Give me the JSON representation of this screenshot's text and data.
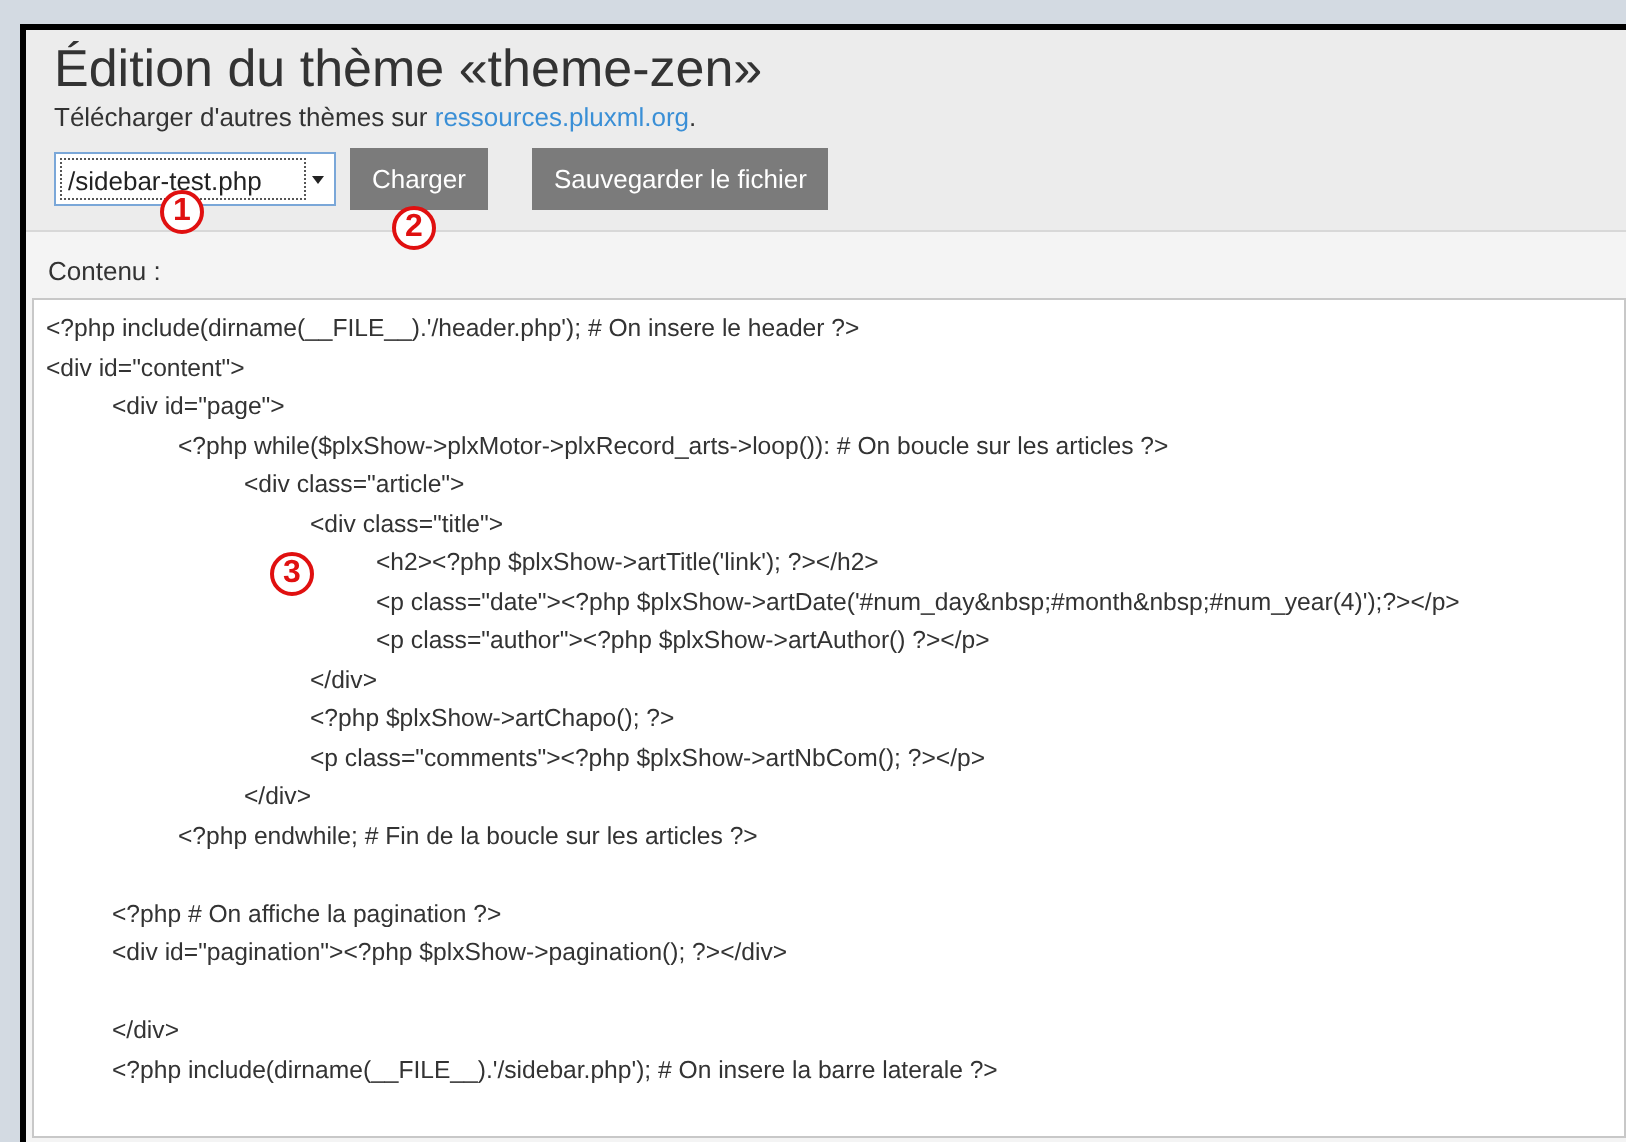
{
  "title": "Édition du thème «theme-zen»",
  "download": {
    "text": "Télécharger d'autres thèmes sur ",
    "link": "ressources.pluxml.org",
    "after": "."
  },
  "file_select": {
    "value": "/sidebar-test.php"
  },
  "buttons": [
    "Charger",
    "Sauvegarder le fichier"
  ],
  "content_label": "Contenu :",
  "content": "<?php include(dirname(__FILE__).'/header.php'); # On insere le header ?>\n<div id=\"content\">\n\t<div id=\"page\">\n\t\t<?php while($plxShow->plxMotor->plxRecord_arts->loop()): # On boucle sur les articles ?>\n\t\t\t<div class=\"article\">\n\t\t\t\t<div class=\"title\">\n\t\t\t\t\t<h2><?php $plxShow->artTitle('link'); ?></h2>\n\t\t\t\t\t<p class=\"date\"><?php $plxShow->artDate('#num_day&nbsp;#month&nbsp;#num_year(4)');?></p>\n\t\t\t\t\t<p class=\"author\"><?php $plxShow->artAuthor() ?></p>\n\t\t\t\t</div>\n\t\t\t\t<?php $plxShow->artChapo(); ?>\n\t\t\t\t<p class=\"comments\"><?php $plxShow->artNbCom(); ?></p>\n\t\t\t</div>\n\t\t<?php endwhile; # Fin de la boucle sur les articles ?>\n\n\t<?php # On affiche la pagination ?>\n\t<div id=\"pagination\"><?php $plxShow->pagination(); ?></div>\n\n\t</div>\n\t<?php include(dirname(__FILE__).'/sidebar.php'); # On insere la barre laterale ?>",
  "annotations": [
    "1",
    "2",
    "3"
  ]
}
